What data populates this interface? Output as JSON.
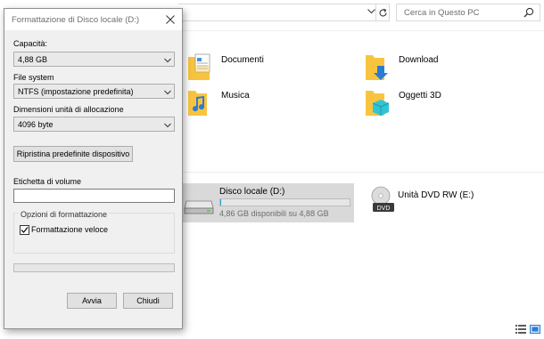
{
  "explorer": {
    "search_placeholder": "Cerca in Questo PC",
    "icons": {
      "chevron": "chevron-down-icon",
      "refresh": "refresh-icon",
      "search": "search-icon"
    },
    "folders": [
      {
        "label": "Documenti",
        "icon": "documents-folder-icon"
      },
      {
        "label": "Download",
        "icon": "download-folder-icon"
      },
      {
        "label": "Musica",
        "icon": "music-folder-icon"
      },
      {
        "label": "Oggetti 3D",
        "icon": "3d-objects-folder-icon"
      }
    ],
    "drives": [
      {
        "name": "Disco locale (D:)",
        "info": "4,86 GB disponibili su 4,88 GB",
        "used_fraction": 0.004,
        "icon": "hard-drive-icon"
      },
      {
        "name": "Unità DVD RW (E:)",
        "icon": "dvd-drive-icon",
        "badge": "DVD"
      }
    ],
    "view_icons": [
      "details-view-icon",
      "large-icons-view-icon"
    ]
  },
  "dialog": {
    "title": "Formattazione di Disco locale (D:)",
    "capacity_label": "Capacità:",
    "capacity_value": "4,88 GB",
    "filesystem_label": "File system",
    "filesystem_value": "NTFS (impostazione predefinita)",
    "allocation_label": "Dimensioni unità di allocazione",
    "allocation_value": "4096 byte",
    "restore_button": "Ripristina predefinite dispositivo",
    "volume_label": "Etichetta di volume",
    "volume_value": "",
    "options_legend": "Opzioni di formattazione",
    "quick_format_label": "Formattazione veloce",
    "quick_format_checked": true,
    "progress": 0,
    "start_button": "Avvia",
    "close_button": "Chiudi"
  },
  "colors": {
    "dialog_bg": "#f0f0f0",
    "selected_drive_bg": "#d9d9d9",
    "folder_yellow": "#f8c440",
    "download_arrow": "#2b7cd3",
    "object3d_cyan": "#31c4d6"
  }
}
